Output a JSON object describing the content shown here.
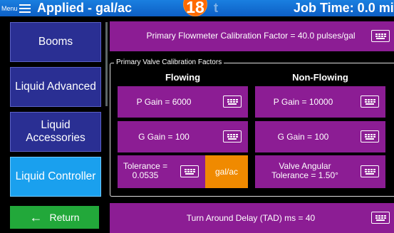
{
  "header": {
    "menu_label": "Menu",
    "title": "Applied - gal/ac",
    "mid_text": "t",
    "job_time": "Job Time: 0.0 min",
    "badge": "18"
  },
  "sidebar": {
    "items": [
      {
        "label": "Booms"
      },
      {
        "label": "Liquid Advanced"
      },
      {
        "label": "Liquid Accessories"
      },
      {
        "label": "Liquid Controller",
        "active": true
      }
    ],
    "return_label": "Return"
  },
  "main": {
    "flowmeter": "Primary Flowmeter Calibration Factor = 40.0 pulses/gal",
    "valve_group_title": "Primary Valve Calibration Factors",
    "flowing_header": "Flowing",
    "non_flowing_header": "Non-Flowing",
    "p_gain_flowing": "P Gain = 6000",
    "p_gain_non_flowing": "P Gain = 10000",
    "g_gain_flowing": "G Gain = 100",
    "g_gain_non_flowing": "G Gain = 100",
    "tolerance_line1": "Tolerance =",
    "tolerance_line2": "0.0535",
    "tolerance_units": "gal/ac",
    "valve_angular_line1": "Valve Angular",
    "valve_angular_line2": "Tolerance = 1.50°",
    "tad": "Turn Around Delay (TAD) ms = 40"
  },
  "icons": {
    "keyboard": "keyboard-icon",
    "return_arrow": "arrow-left-icon",
    "menu": "hamburger-icon"
  },
  "colors": {
    "header": "#0d5fc4",
    "sidebar_button": "#2a2f93",
    "sidebar_active": "#1aa0ee",
    "field_button": "#8c1d94",
    "units_button": "#f08a00",
    "return_button": "#22a83a",
    "badge": "#ff6a00"
  }
}
